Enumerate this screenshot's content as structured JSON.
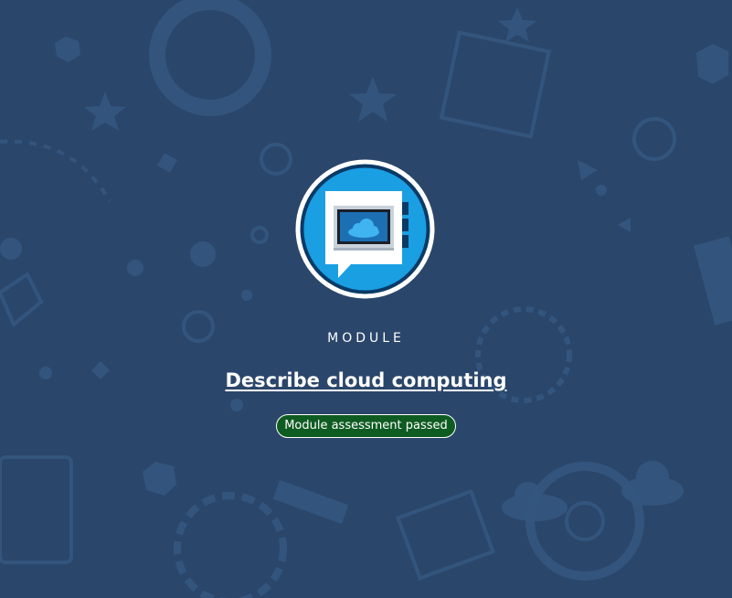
{
  "module": {
    "eyebrow": "MODULE",
    "title": "Describe cloud computing",
    "status_badge": "Module assessment passed",
    "icon": "cloud-chat-icon"
  },
  "colors": {
    "background": "#2b466b",
    "pattern": "#335a86",
    "badge_blue": "#1a9fe3",
    "status_green": "#0f5c22",
    "text": "#ffffff"
  }
}
